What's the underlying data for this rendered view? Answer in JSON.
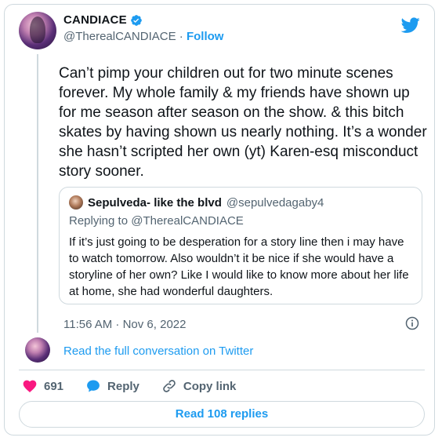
{
  "author": {
    "name": "CANDIACE",
    "handle": "@TherealCANDIACE",
    "separator": "·",
    "follow_label": "Follow"
  },
  "tweet": {
    "text": "Can’t pimp your children out for two minute scenes forever. My whole family & my friends have shown up for me season after season on the show. & this bitch skates by having shown us nearly nothing. It’s a wonder she hasn’t scripted her own (yt) Karen-esq misconduct story sooner.",
    "timestamp": "11:56 AM · Nov 6, 2022"
  },
  "quote": {
    "name": "Sepulveda- like the blvd",
    "handle": "@sepulvedagaby4",
    "replying_to": "Replying to @TherealCANDIACE",
    "text": "If it’s just going to be desperation for a story line then i may have to watch tomorrow. Also wouldn’t it be nice if she would have a storyline of her own? Like I would like to know more about her life at home, she had wonderful daughters."
  },
  "thread": {
    "read_conversation_label": "Read the full conversation on Twitter"
  },
  "actions": {
    "likes": "691",
    "reply_label": "Reply",
    "copy_link_label": "Copy link"
  },
  "replies": {
    "label": "Read 108 replies"
  },
  "icons": {
    "verified": "verified-badge-icon",
    "brand": "twitter-bird-icon",
    "info": "info-icon",
    "like": "heart-icon",
    "reply": "reply-bubble-icon",
    "link": "link-icon"
  },
  "colors": {
    "accent": "#1d9bf0",
    "like": "#f91880",
    "secondary_text": "#536471",
    "border": "#cfd9de"
  }
}
